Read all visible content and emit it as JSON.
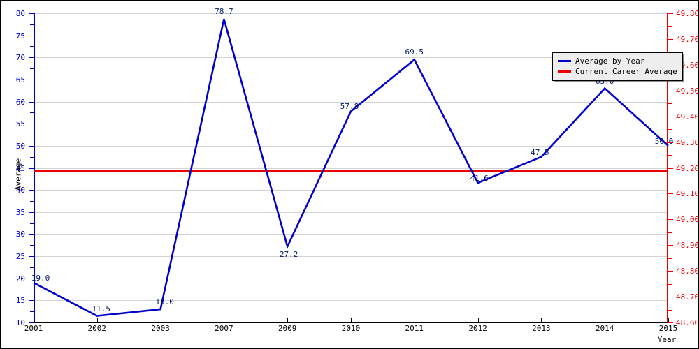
{
  "chart_data": {
    "type": "line",
    "title": "",
    "xlabel": "Year",
    "ylabel": "Average",
    "categories": [
      "2001",
      "2002",
      "2003",
      "2007",
      "2009",
      "2010",
      "2011",
      "2012",
      "2013",
      "2014",
      "2015"
    ],
    "series": [
      {
        "name": "Average by Year",
        "color": "#0000cc",
        "values": [
          19.0,
          11.5,
          13.0,
          78.7,
          27.2,
          57.8,
          69.5,
          41.6,
          47.5,
          63.0,
          50.0
        ],
        "point_labels": [
          "19.0",
          "11.5",
          "13.0",
          "78.7",
          "27.2",
          "57.8",
          "69.5",
          "41.6",
          "47.5",
          "63.0",
          "50.0"
        ]
      },
      {
        "name": "Current Career Average",
        "color": "#ee0000",
        "type": "hline",
        "value": 44.3
      }
    ],
    "grid": true,
    "legend_position": "top-right",
    "axes": {
      "left": {
        "label": "Average",
        "color": "#0000cc",
        "min": 10,
        "max": 80,
        "tick_step": 5,
        "ticks": [
          "10",
          "15",
          "20",
          "25",
          "30",
          "35",
          "40",
          "45",
          "50",
          "55",
          "60",
          "65",
          "70",
          "75",
          "80"
        ]
      },
      "right": {
        "label": "",
        "color": "#ee0000",
        "min": 48.6,
        "max": 49.8,
        "tick_step": 0.1,
        "ticks": [
          "48.60",
          "48.70",
          "48.80",
          "48.90",
          "49.00",
          "49.10",
          "49.20",
          "49.30",
          "49.40",
          "49.50",
          "49.60",
          "49.70",
          "49.80"
        ]
      },
      "bottom": {
        "label": "Year",
        "color": "#000000",
        "ticks": [
          "2001",
          "2002",
          "2003",
          "2007",
          "2009",
          "2010",
          "2011",
          "2012",
          "2013",
          "2014",
          "2015"
        ]
      }
    }
  },
  "legend": {
    "entries": [
      {
        "label": "Average by Year",
        "color": "#0000cc"
      },
      {
        "label": "Current Career Average",
        "color": "#ee0000"
      }
    ]
  }
}
